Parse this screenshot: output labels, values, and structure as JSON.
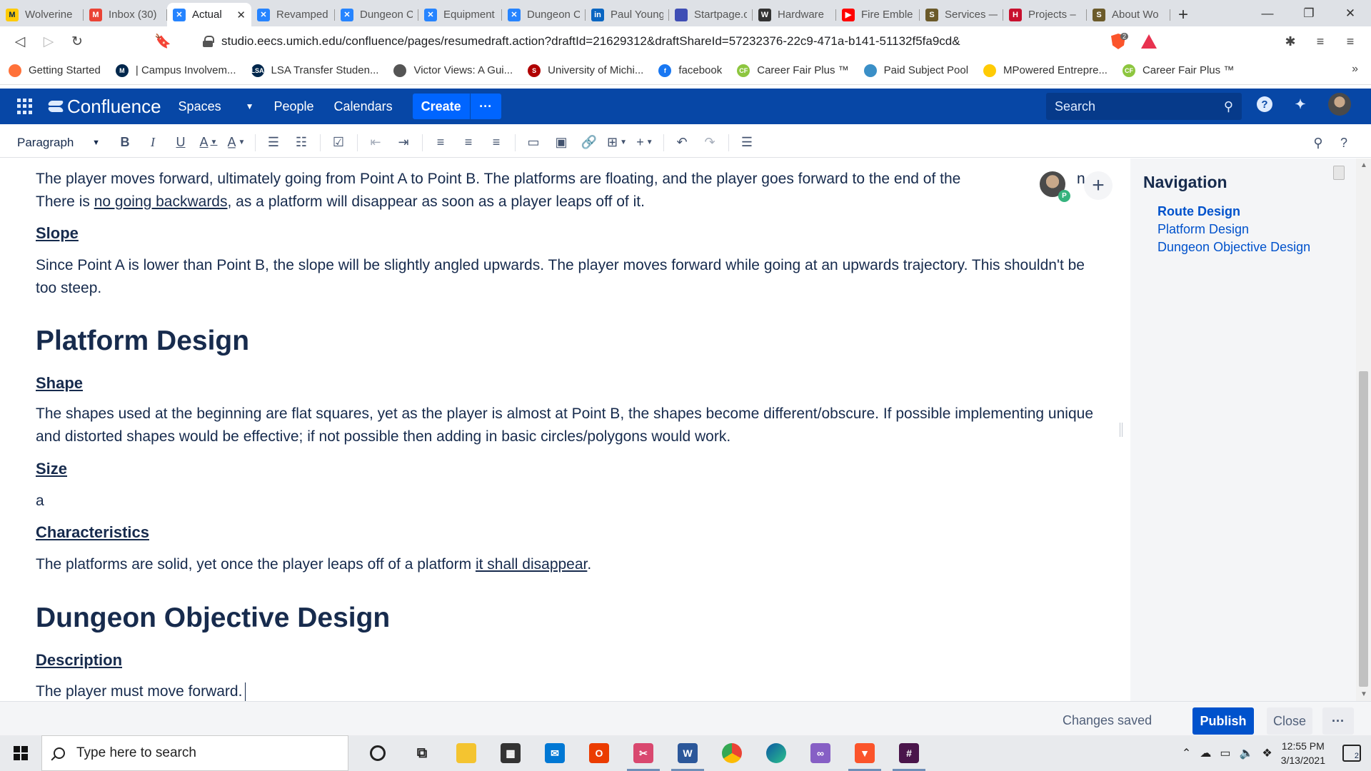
{
  "browser": {
    "tabs": [
      {
        "label": "Wolverine",
        "icon": "michigan-m-icon",
        "color": "#ffcb05",
        "glyph": "M"
      },
      {
        "label": "Inbox (30)",
        "icon": "gmail-icon",
        "color": "#ea4335",
        "glyph": "M"
      },
      {
        "label": "Actual",
        "icon": "confluence-icon",
        "color": "#2684ff",
        "glyph": "✕",
        "active": true
      },
      {
        "label": "Revamped",
        "icon": "confluence-icon",
        "color": "#2684ff",
        "glyph": "✕"
      },
      {
        "label": "Dungeon C",
        "icon": "confluence-icon",
        "color": "#2684ff",
        "glyph": "✕"
      },
      {
        "label": "Equipment",
        "icon": "confluence-icon",
        "color": "#2684ff",
        "glyph": "✕"
      },
      {
        "label": "Dungeon C",
        "icon": "confluence-icon",
        "color": "#2684ff",
        "glyph": "✕"
      },
      {
        "label": "Paul Young",
        "icon": "linkedin-icon",
        "color": "#0a66c2",
        "glyph": "in"
      },
      {
        "label": "Startpage.c",
        "icon": "startpage-icon",
        "color": "#3f4eb5",
        "glyph": ""
      },
      {
        "label": "Hardware",
        "icon": "wordpress-icon",
        "color": "#333333",
        "glyph": "W"
      },
      {
        "label": "Fire Emble",
        "icon": "youtube-icon",
        "color": "#ff0000",
        "glyph": "▶"
      },
      {
        "label": "Services —",
        "icon": "site-icon",
        "color": "#6b5a2a",
        "glyph": "S"
      },
      {
        "label": "Projects –",
        "icon": "harvard-h-icon",
        "color": "#c8102e",
        "glyph": "H"
      },
      {
        "label": "About Wo",
        "icon": "site-icon",
        "color": "#6b5a2a",
        "glyph": "S"
      }
    ],
    "url": "studio.eecs.umich.edu/confluence/pages/resumedraft.action?draftId=21629312&draftShareId=57232376-22c9-471a-b141-51132f5fa9cd&",
    "shield_count": "2",
    "bookmarks": [
      {
        "label": "Getting Started",
        "color": "#ff7139",
        "glyph": ""
      },
      {
        "label": "| Campus Involvem...",
        "color": "#00274c",
        "glyph": "M"
      },
      {
        "label": "LSA Transfer Studen...",
        "color": "#00274c",
        "glyph": "LSA"
      },
      {
        "label": "Victor Views: A Gui...",
        "color": "#555555",
        "glyph": ""
      },
      {
        "label": "University of Michi...",
        "color": "#b00000",
        "glyph": "S"
      },
      {
        "label": "facebook",
        "color": "#1877f2",
        "glyph": "f"
      },
      {
        "label": "Career Fair Plus ™",
        "color": "#8dc63f",
        "glyph": "CF"
      },
      {
        "label": "Paid Subject Pool",
        "color": "#3a8fc7",
        "glyph": ""
      },
      {
        "label": "MPowered Entrepre...",
        "color": "#ffcb05",
        "glyph": ""
      },
      {
        "label": "Career Fair Plus ™",
        "color": "#8dc63f",
        "glyph": "CF"
      }
    ]
  },
  "confluence": {
    "logo": "Confluence",
    "nav": {
      "spaces": "Spaces",
      "people": "People",
      "calendars": "Calendars"
    },
    "create": "Create",
    "more": "···",
    "search_placeholder": "Search",
    "help": "?"
  },
  "toolbar": {
    "paragraph": "Paragraph"
  },
  "content": {
    "intro_line1": "The player moves forward, ultimately going from Point A to Point B. The platforms are floating, and the player goes forward to the end of the",
    "intro_line1_end": "n.",
    "intro_line2_pre": "There is ",
    "intro_line2_link": "no going backwards",
    "intro_line2_post": ", as a platform will disappear as soon as a player leaps off of it.",
    "slope_heading": "Slope",
    "slope_text": "Since Point A is lower than Point B, the slope will be slightly angled upwards. The player moves forward while going at an upwards trajectory. This shouldn't be too steep.",
    "platform_heading": "Platform Design",
    "shape_heading": "Shape",
    "shape_text": "The shapes used at the beginning are flat squares, yet as the player is almost at Point B, the shapes become different/obscure. If possible implementing unique and distorted shapes would be effective; if not possible then adding in basic circles/polygons would work.",
    "size_heading": "Size",
    "size_text": "a",
    "char_heading": "Characteristics",
    "char_text_pre": "The platforms are solid, yet once the player leaps off of a platform ",
    "char_text_link": "it shall disappear",
    "char_text_post": ".",
    "dungeon_heading": "Dungeon Objective Design",
    "desc_heading": "Description",
    "desc_text": "The player must move forward.",
    "collab_badge": "P"
  },
  "navigation": {
    "title": "Navigation",
    "links": [
      "Route Design",
      "Platform Design",
      "Dungeon Objective Design"
    ]
  },
  "footer": {
    "status": "Changes saved",
    "publish": "Publish",
    "close": "Close",
    "more": "···"
  },
  "taskbar": {
    "search_placeholder": "Type here to search",
    "time": "12:55 PM",
    "date": "3/13/2021",
    "notifications": "2"
  }
}
